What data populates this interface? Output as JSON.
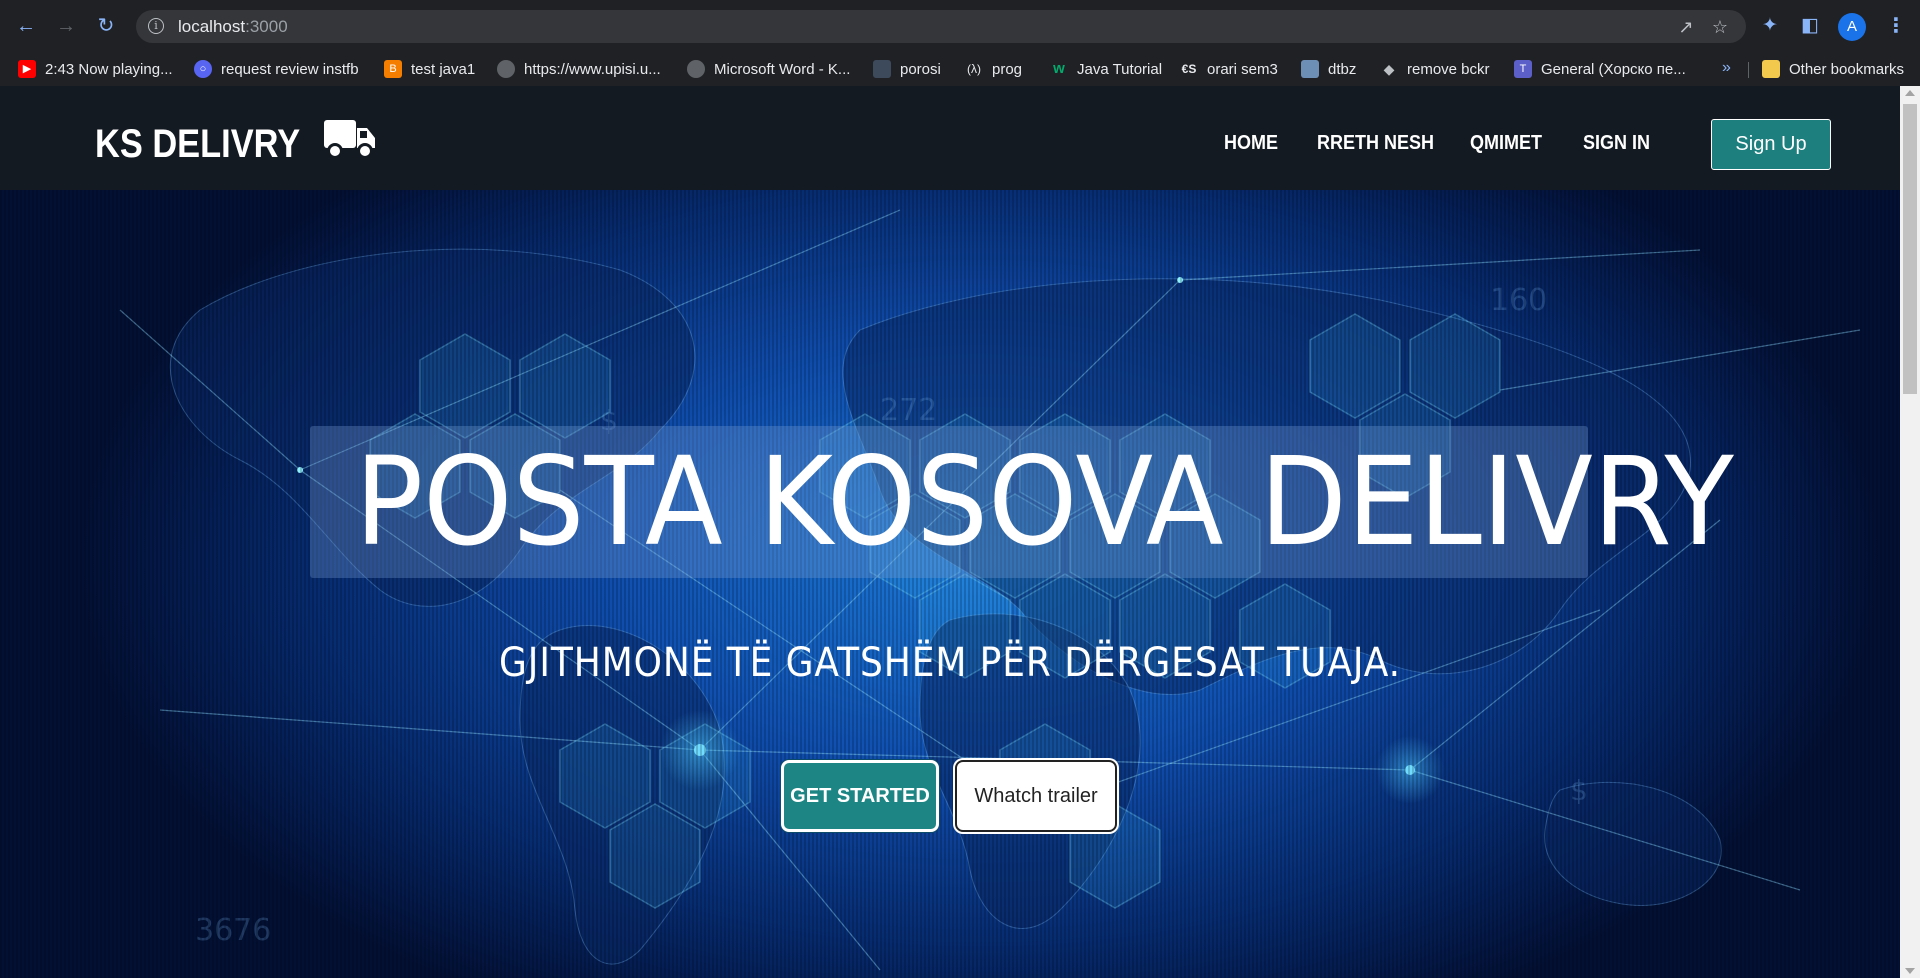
{
  "browser": {
    "url_host": "localhost",
    "url_port": ":3000",
    "profile_initial": "A",
    "bookmarks": [
      {
        "label": "2:43 Now playing...",
        "icon": "youtube-icon",
        "color": "#ff0000"
      },
      {
        "label": "request review instfb",
        "icon": "headset-icon",
        "color": "#5865f2"
      },
      {
        "label": "test java1",
        "icon": "blogger-icon",
        "color": "#f57d00"
      },
      {
        "label": "https://www.upisi.u...",
        "icon": "globe-icon",
        "color": "#5f6368"
      },
      {
        "label": "Microsoft Word - K...",
        "icon": "globe-icon",
        "color": "#5f6368"
      },
      {
        "label": "porosi",
        "icon": "page-icon",
        "color": "#3c4a5c"
      },
      {
        "label": "prog",
        "icon": "lambda-icon",
        "color": "#202124"
      },
      {
        "label": "Java Tutorial",
        "icon": "w3schools-icon",
        "color": "#04aa6d"
      },
      {
        "label": "orari sem3",
        "icon": "cs-icon",
        "color": "#202124"
      },
      {
        "label": "dtbz",
        "icon": "profile-page-icon",
        "color": "#6d8fb5"
      },
      {
        "label": "remove bckr",
        "icon": "layers-icon",
        "color": "#202124"
      },
      {
        "label": "General (Хорско пе...",
        "icon": "teams-icon",
        "color": "#5b5fc7"
      }
    ],
    "more": "»",
    "other_bookmarks": "Other bookmarks"
  },
  "site": {
    "brand": "KS DELIVRY",
    "nav": [
      "HOME",
      "RRETH NESH",
      "QMIMET",
      "SIGN IN"
    ],
    "signup": "Sign Up",
    "accent": "#1e8585"
  },
  "hero": {
    "title": "POSTA KOSOVA DELIVRY",
    "subtitle": "GJITHMONË TË GATSHËM PËR DËRGESAT TUAJA.",
    "cta_primary": "GET STARTED",
    "cta_secondary": "Whatch trailer"
  }
}
